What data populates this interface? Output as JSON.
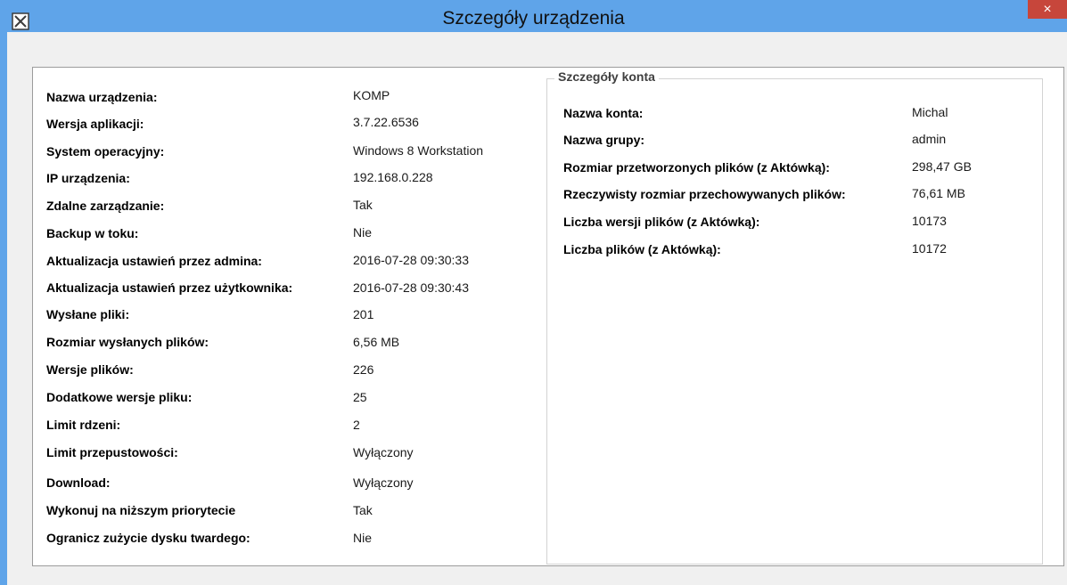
{
  "window": {
    "title": "Szczegóły urządzenia",
    "close_label": "×",
    "accent_color": "#5fa4e9",
    "close_color": "#c7463b"
  },
  "device": {
    "rows": [
      {
        "label": "Nazwa urządzenia:",
        "value": "KOMP"
      },
      {
        "label": "Wersja aplikacji:",
        "value": "3.7.22.6536"
      },
      {
        "label": "System operacyjny:",
        "value": "Windows 8 Workstation"
      },
      {
        "label": "IP urządzenia:",
        "value": "192.168.0.228"
      },
      {
        "label": "Zdalne zarządzanie:",
        "value": "Tak"
      },
      {
        "label": "Backup w toku:",
        "value": "Nie"
      },
      {
        "label": "Aktualizacja ustawień przez admina:",
        "value": "2016-07-28 09:30:33"
      },
      {
        "label": "Aktualizacja ustawień przez użytkownika:",
        "value": "2016-07-28 09:30:43"
      },
      {
        "label": "Wysłane pliki:",
        "value": "201"
      },
      {
        "label": "Rozmiar wysłanych plików:",
        "value": "6,56 MB"
      },
      {
        "label": "Wersje plików:",
        "value": "226"
      },
      {
        "label": "Dodatkowe wersje pliku:",
        "value": "25"
      },
      {
        "label": "Limit rdzeni:",
        "value": "2"
      },
      {
        "label": "Limit przepustowości:",
        "value": "Wyłączony"
      },
      {
        "label": "Download:",
        "value": "Wyłączony"
      },
      {
        "label": "Wykonuj na niższym priorytecie",
        "value": "Tak"
      },
      {
        "label": "Ogranicz zużycie dysku twardego:",
        "value": "Nie"
      }
    ]
  },
  "account": {
    "legend": "Szczegóły konta",
    "rows": [
      {
        "label": "Nazwa konta:",
        "value": "Michal"
      },
      {
        "label": "Nazwa grupy:",
        "value": "admin"
      },
      {
        "label": "Rozmiar przetworzonych plików (z Aktówką):",
        "value": "298,47 GB"
      },
      {
        "label": "Rzeczywisty rozmiar przechowywanych plików:",
        "value": "76,61 MB"
      },
      {
        "label": "Liczba wersji plików (z Aktówką):",
        "value": "10173"
      },
      {
        "label": "Liczba plików (z Aktówką):",
        "value": "10172"
      }
    ]
  }
}
